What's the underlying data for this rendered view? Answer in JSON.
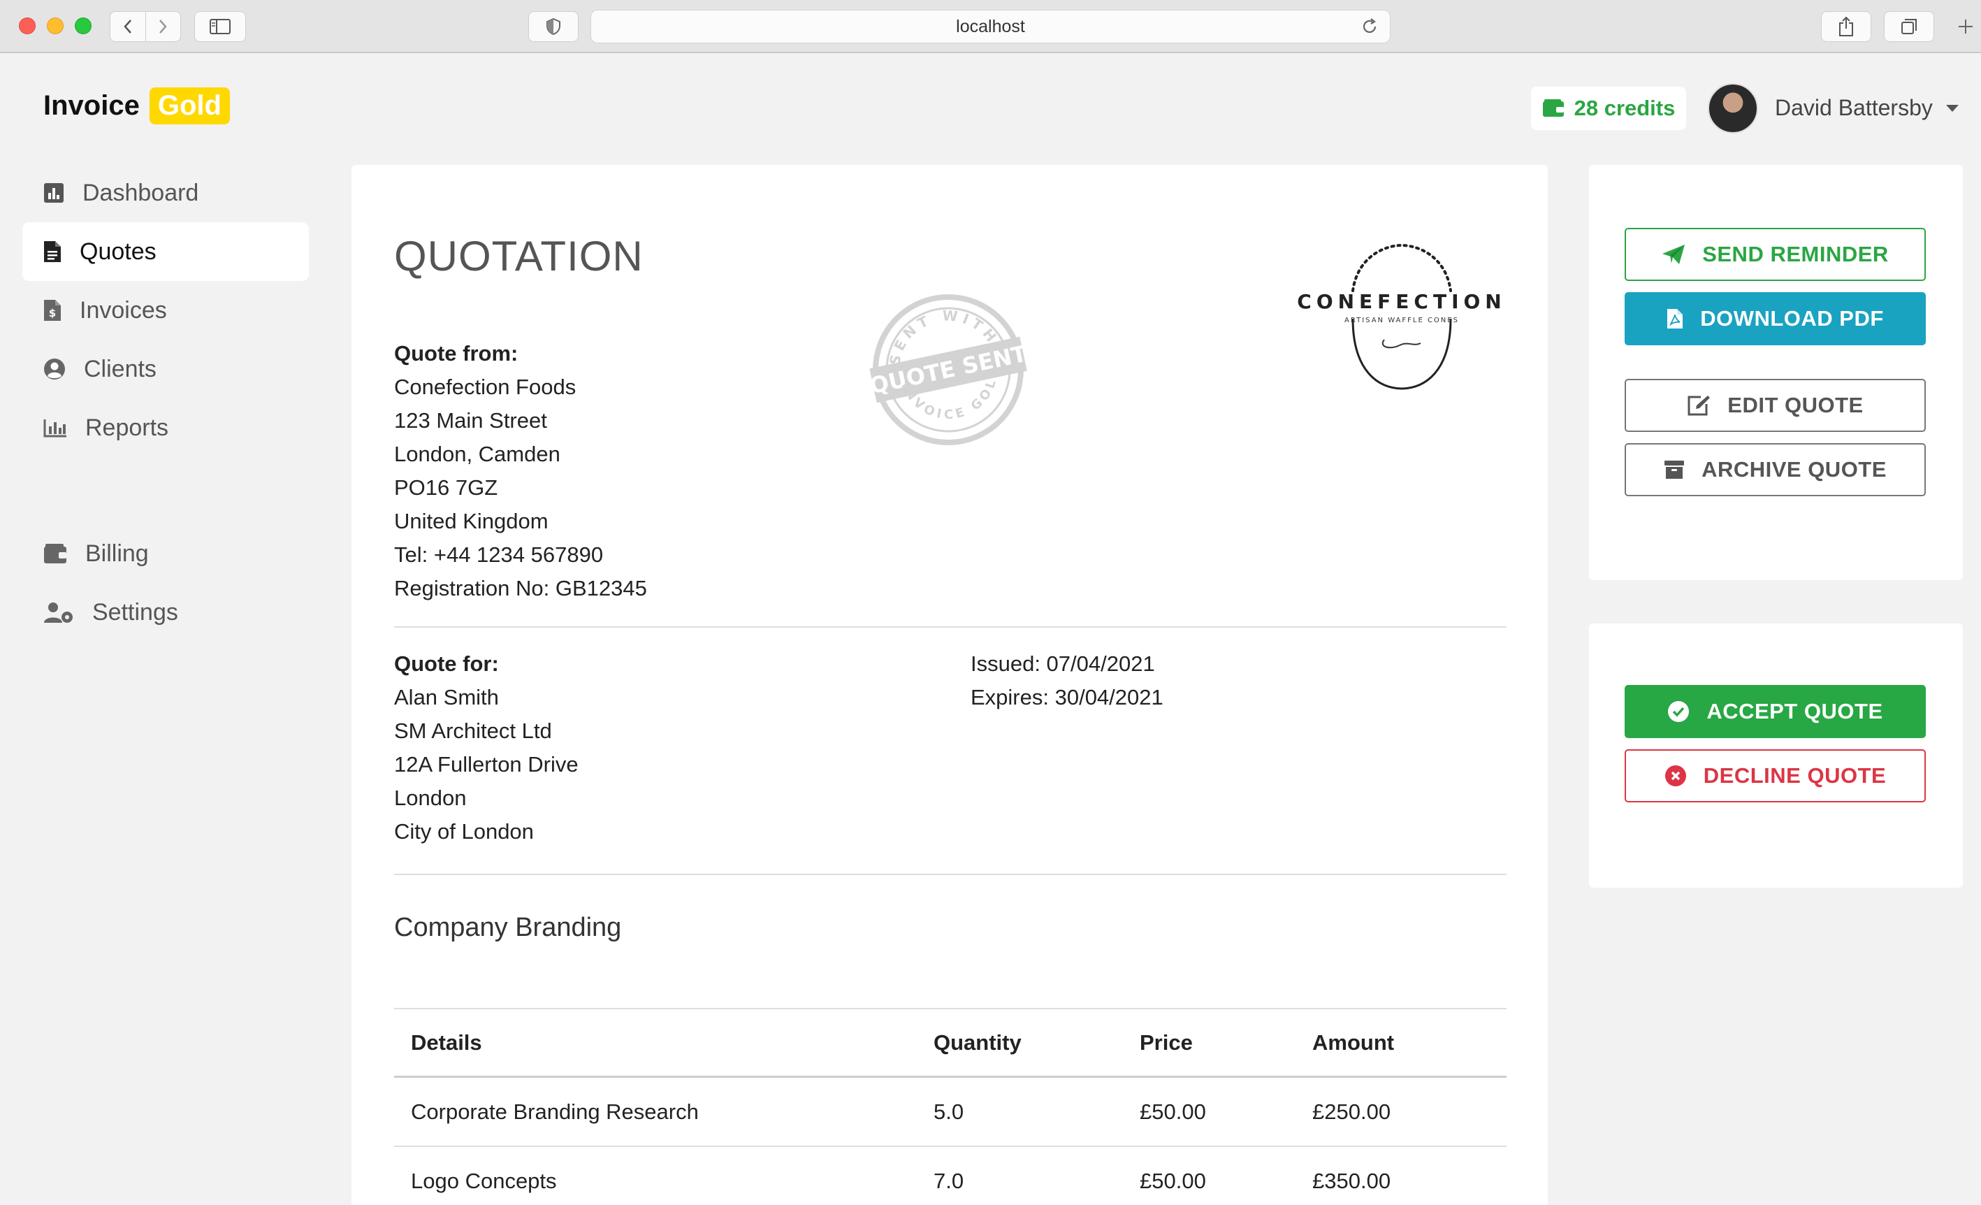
{
  "browser": {
    "url": "localhost"
  },
  "app": {
    "logo_text": "Invoice",
    "logo_badge": "Gold",
    "credits": "28 credits",
    "user_name": "David Battersby"
  },
  "sidebar": {
    "items": [
      {
        "label": "Dashboard",
        "icon": "chart-square-icon"
      },
      {
        "label": "Quotes",
        "icon": "document-icon"
      },
      {
        "label": "Invoices",
        "icon": "invoice-icon"
      },
      {
        "label": "Clients",
        "icon": "user-circle-icon"
      },
      {
        "label": "Reports",
        "icon": "bar-chart-icon"
      },
      {
        "label": "Billing",
        "icon": "wallet-icon"
      },
      {
        "label": "Settings",
        "icon": "user-cog-icon"
      }
    ],
    "active": "Quotes"
  },
  "quote": {
    "title": "QUOTATION",
    "stamp": {
      "top_text": "SENT WITH",
      "center_text": "QUOTE SENT",
      "bottom_text": "INVOICE GOLD"
    },
    "brand": {
      "name": "CONEFECTION",
      "tagline": "ARTISAN WAFFLE CONES"
    },
    "from": {
      "label": "Quote from:",
      "lines": [
        "Conefection Foods",
        "123 Main Street",
        "London, Camden",
        "PO16 7GZ",
        "United Kingdom",
        "Tel: +44 1234 567890",
        "Registration No: GB12345"
      ]
    },
    "for": {
      "label": "Quote for:",
      "lines": [
        "Alan Smith",
        "SM Architect Ltd",
        "12A Fullerton Drive",
        "London",
        "City of London"
      ]
    },
    "issued": "Issued: 07/04/2021",
    "expires": "Expires: 30/04/2021",
    "section_title": "Company Branding",
    "table": {
      "headers": [
        "Details",
        "Quantity",
        "Price",
        "Amount"
      ],
      "rows": [
        [
          "Corporate Branding Research",
          "5.0",
          "£50.00",
          "£250.00"
        ],
        [
          "Logo Concepts",
          "7.0",
          "£50.00",
          "£350.00"
        ]
      ]
    }
  },
  "actions": {
    "send_reminder": "SEND REMINDER",
    "download_pdf": "DOWNLOAD PDF",
    "edit_quote": "EDIT QUOTE",
    "archive_quote": "ARCHIVE QUOTE",
    "accept_quote": "ACCEPT QUOTE",
    "decline_quote": "DECLINE QUOTE"
  },
  "colors": {
    "gold": "#ffd800",
    "green": "#28a745",
    "teal": "#1aa2c1",
    "red": "#dc3545"
  }
}
